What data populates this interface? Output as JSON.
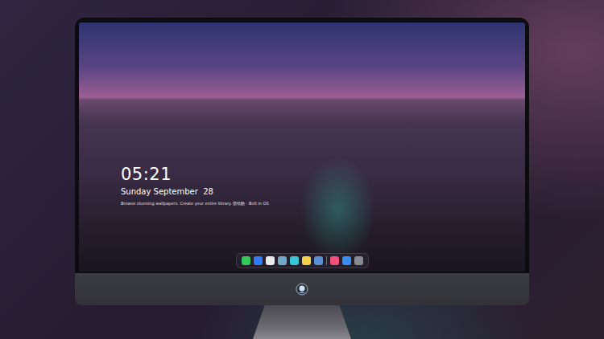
{
  "lock_screen": {
    "time": "05:21",
    "date": "Sunday September  28",
    "caption": "Browse stunning wallpapers. Create your entire library. 壁纸酷 · Bolt in OS"
  },
  "dock": {
    "apps": [
      {
        "color": "#34c759"
      },
      {
        "color": "#2f7cf6"
      },
      {
        "color": "#e8e8ea"
      },
      {
        "color": "#6fa8c8"
      },
      {
        "color": "#3bc6d6"
      },
      {
        "color": "#f5d24a"
      },
      {
        "color": "#5a8fd0"
      }
    ],
    "utilities": [
      {
        "color": "#f0507a"
      },
      {
        "color": "#3a8df2"
      },
      {
        "color": "#8a8a92"
      }
    ]
  }
}
